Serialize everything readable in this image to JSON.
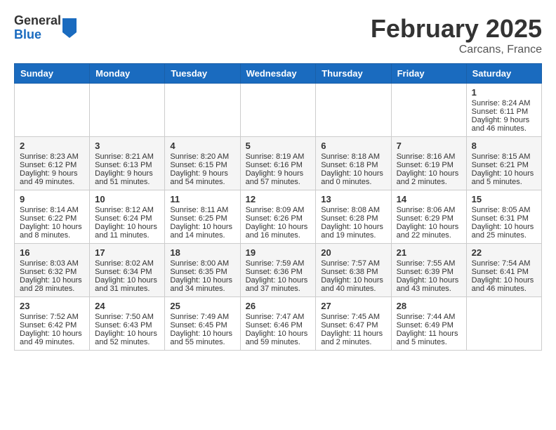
{
  "header": {
    "logo_general": "General",
    "logo_blue": "Blue",
    "month_title": "February 2025",
    "location": "Carcans, France"
  },
  "calendar": {
    "days_of_week": [
      "Sunday",
      "Monday",
      "Tuesday",
      "Wednesday",
      "Thursday",
      "Friday",
      "Saturday"
    ],
    "weeks": [
      [
        {
          "day": "",
          "info": ""
        },
        {
          "day": "",
          "info": ""
        },
        {
          "day": "",
          "info": ""
        },
        {
          "day": "",
          "info": ""
        },
        {
          "day": "",
          "info": ""
        },
        {
          "day": "",
          "info": ""
        },
        {
          "day": "1",
          "info": "Sunrise: 8:24 AM\nSunset: 6:11 PM\nDaylight: 9 hours and 46 minutes."
        }
      ],
      [
        {
          "day": "2",
          "info": "Sunrise: 8:23 AM\nSunset: 6:12 PM\nDaylight: 9 hours and 49 minutes."
        },
        {
          "day": "3",
          "info": "Sunrise: 8:21 AM\nSunset: 6:13 PM\nDaylight: 9 hours and 51 minutes."
        },
        {
          "day": "4",
          "info": "Sunrise: 8:20 AM\nSunset: 6:15 PM\nDaylight: 9 hours and 54 minutes."
        },
        {
          "day": "5",
          "info": "Sunrise: 8:19 AM\nSunset: 6:16 PM\nDaylight: 9 hours and 57 minutes."
        },
        {
          "day": "6",
          "info": "Sunrise: 8:18 AM\nSunset: 6:18 PM\nDaylight: 10 hours and 0 minutes."
        },
        {
          "day": "7",
          "info": "Sunrise: 8:16 AM\nSunset: 6:19 PM\nDaylight: 10 hours and 2 minutes."
        },
        {
          "day": "8",
          "info": "Sunrise: 8:15 AM\nSunset: 6:21 PM\nDaylight: 10 hours and 5 minutes."
        }
      ],
      [
        {
          "day": "9",
          "info": "Sunrise: 8:14 AM\nSunset: 6:22 PM\nDaylight: 10 hours and 8 minutes."
        },
        {
          "day": "10",
          "info": "Sunrise: 8:12 AM\nSunset: 6:24 PM\nDaylight: 10 hours and 11 minutes."
        },
        {
          "day": "11",
          "info": "Sunrise: 8:11 AM\nSunset: 6:25 PM\nDaylight: 10 hours and 14 minutes."
        },
        {
          "day": "12",
          "info": "Sunrise: 8:09 AM\nSunset: 6:26 PM\nDaylight: 10 hours and 16 minutes."
        },
        {
          "day": "13",
          "info": "Sunrise: 8:08 AM\nSunset: 6:28 PM\nDaylight: 10 hours and 19 minutes."
        },
        {
          "day": "14",
          "info": "Sunrise: 8:06 AM\nSunset: 6:29 PM\nDaylight: 10 hours and 22 minutes."
        },
        {
          "day": "15",
          "info": "Sunrise: 8:05 AM\nSunset: 6:31 PM\nDaylight: 10 hours and 25 minutes."
        }
      ],
      [
        {
          "day": "16",
          "info": "Sunrise: 8:03 AM\nSunset: 6:32 PM\nDaylight: 10 hours and 28 minutes."
        },
        {
          "day": "17",
          "info": "Sunrise: 8:02 AM\nSunset: 6:34 PM\nDaylight: 10 hours and 31 minutes."
        },
        {
          "day": "18",
          "info": "Sunrise: 8:00 AM\nSunset: 6:35 PM\nDaylight: 10 hours and 34 minutes."
        },
        {
          "day": "19",
          "info": "Sunrise: 7:59 AM\nSunset: 6:36 PM\nDaylight: 10 hours and 37 minutes."
        },
        {
          "day": "20",
          "info": "Sunrise: 7:57 AM\nSunset: 6:38 PM\nDaylight: 10 hours and 40 minutes."
        },
        {
          "day": "21",
          "info": "Sunrise: 7:55 AM\nSunset: 6:39 PM\nDaylight: 10 hours and 43 minutes."
        },
        {
          "day": "22",
          "info": "Sunrise: 7:54 AM\nSunset: 6:41 PM\nDaylight: 10 hours and 46 minutes."
        }
      ],
      [
        {
          "day": "23",
          "info": "Sunrise: 7:52 AM\nSunset: 6:42 PM\nDaylight: 10 hours and 49 minutes."
        },
        {
          "day": "24",
          "info": "Sunrise: 7:50 AM\nSunset: 6:43 PM\nDaylight: 10 hours and 52 minutes."
        },
        {
          "day": "25",
          "info": "Sunrise: 7:49 AM\nSunset: 6:45 PM\nDaylight: 10 hours and 55 minutes."
        },
        {
          "day": "26",
          "info": "Sunrise: 7:47 AM\nSunset: 6:46 PM\nDaylight: 10 hours and 59 minutes."
        },
        {
          "day": "27",
          "info": "Sunrise: 7:45 AM\nSunset: 6:47 PM\nDaylight: 11 hours and 2 minutes."
        },
        {
          "day": "28",
          "info": "Sunrise: 7:44 AM\nSunset: 6:49 PM\nDaylight: 11 hours and 5 minutes."
        },
        {
          "day": "",
          "info": ""
        }
      ]
    ]
  }
}
